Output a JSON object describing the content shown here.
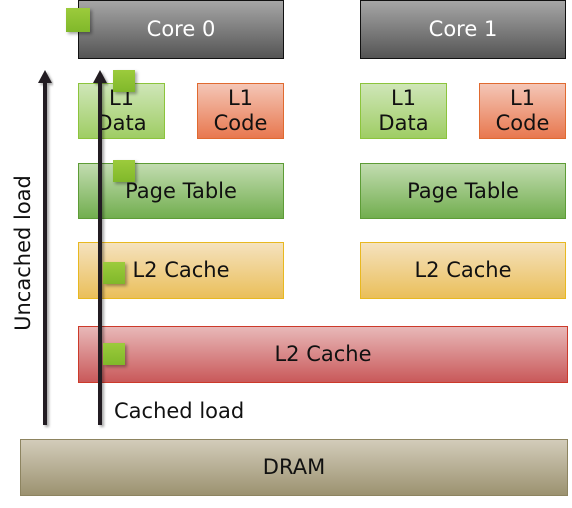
{
  "cores": [
    {
      "name": "Core 0",
      "l1_data": "L1\nData",
      "l1_code": "L1\nCode",
      "page_table": "Page Table",
      "l2": "L2 Cache"
    },
    {
      "name": "Core 1",
      "l1_data": "L1\nData",
      "l1_code": "L1\nCode",
      "page_table": "Page Table",
      "l2": "L2 Cache"
    }
  ],
  "shared_cache": "L2 Cache",
  "dram": "DRAM",
  "labels": {
    "uncached": "Uncached load",
    "cached": "Cached load"
  },
  "colors": {
    "marker": "#8cc43c",
    "core": "#777777",
    "l1_data": "#b5da8c",
    "l1_code": "#ee9a7c",
    "page_table": "#9cc580",
    "l2": "#efd08c",
    "shared_cache": "#d98888",
    "dram": "#b6ae94"
  }
}
